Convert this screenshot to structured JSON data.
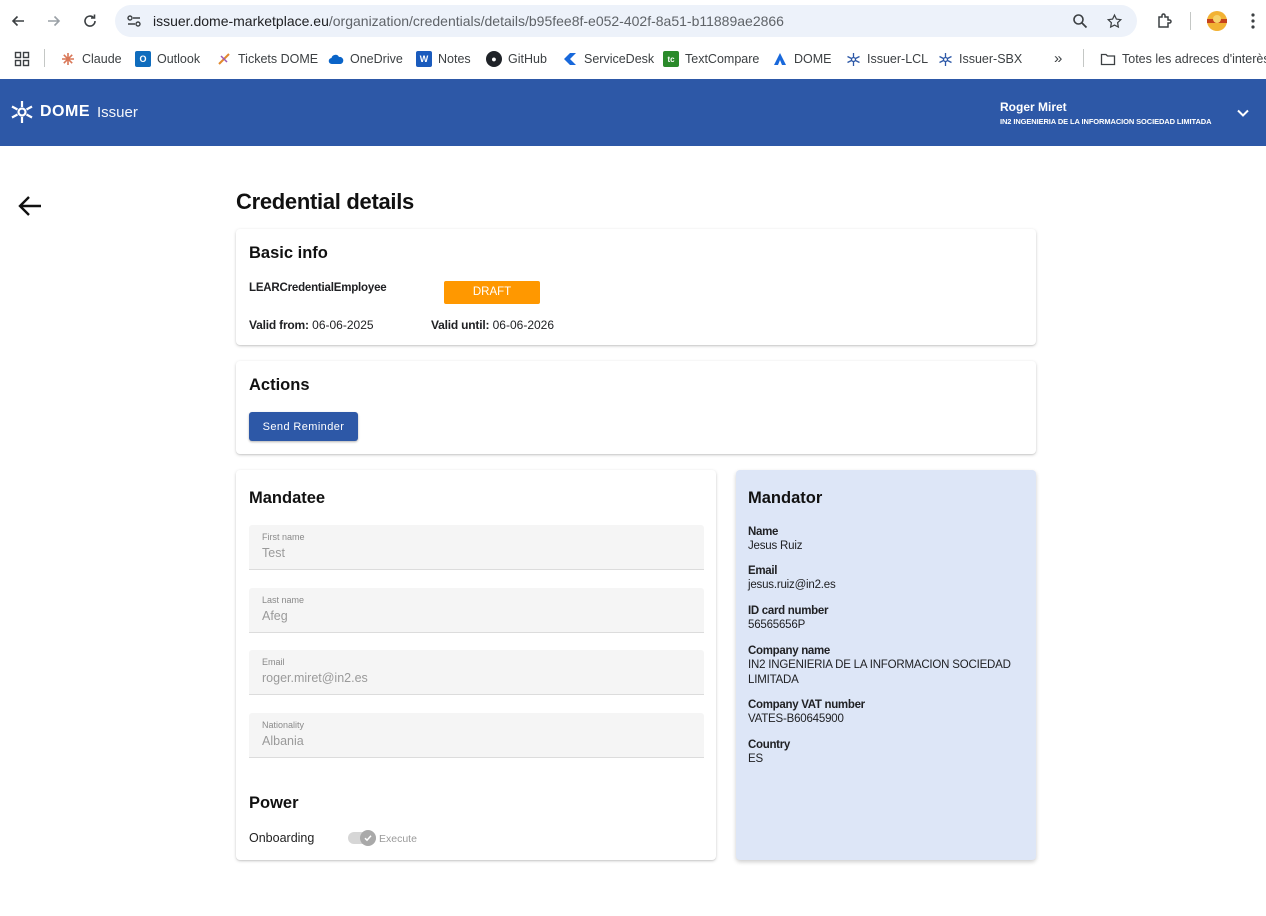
{
  "browser": {
    "url_host": "issuer.dome-marketplace.eu",
    "url_path": "/organization/credentials/details/b95fee8f-e052-402f-8a51-b11889ae2866",
    "bookmarks": [
      {
        "label": "Claude",
        "icon": "claude-icon",
        "color": "#d97757"
      },
      {
        "label": "Outlook",
        "icon": "outlook-icon",
        "color": "#0f6cbd"
      },
      {
        "label": "Tickets DOME",
        "icon": "tickets-icon",
        "color": "#e2892e"
      },
      {
        "label": "OneDrive",
        "icon": "onedrive-icon",
        "color": "#0a64c8"
      },
      {
        "label": "Notes",
        "icon": "word-icon",
        "color": "#1a5bbd"
      },
      {
        "label": "GitHub",
        "icon": "github-icon",
        "color": "#1f2328"
      },
      {
        "label": "ServiceDesk",
        "icon": "servicedesk-icon",
        "color": "#1868db"
      },
      {
        "label": "TextCompare",
        "icon": "textcompare-icon",
        "color": "#2a8a2a"
      },
      {
        "label": "DOME",
        "icon": "dome-icon",
        "color": "#1868db"
      },
      {
        "label": "Issuer-LCL",
        "icon": "issuer-icon",
        "color": "#2d58a7"
      },
      {
        "label": "Issuer-SBX",
        "icon": "issuer-icon",
        "color": "#2d58a7"
      }
    ],
    "more_label": "»",
    "all_bookmarks_label": "Totes les adreces d'interès"
  },
  "header": {
    "brand": "DOME",
    "product": "Issuer",
    "user_name": "Roger Miret",
    "user_org": "IN2 INGENIERIA DE LA INFORMACION SOCIEDAD LIMITADA",
    "color": "#2d58a7"
  },
  "page": {
    "title": "Credential details"
  },
  "basic_info": {
    "title": "Basic info",
    "credential_type": "LEARCredentialEmployee",
    "status": "DRAFT",
    "status_color": "#ff9800",
    "valid_from_label": "Valid from:",
    "valid_from": "06-06-2025",
    "valid_until_label": "Valid until:",
    "valid_until": "06-06-2026"
  },
  "actions": {
    "title": "Actions",
    "send_reminder_label": "Send Reminder"
  },
  "mandatee": {
    "title": "Mandatee",
    "fields": [
      {
        "label": "First name",
        "value": "Test"
      },
      {
        "label": "Last name",
        "value": "Afeg"
      },
      {
        "label": "Email",
        "value": "roger.miret@in2.es"
      },
      {
        "label": "Nationality",
        "value": "Albania"
      }
    ],
    "power_title": "Power",
    "power_label": "Onboarding",
    "power_action": "Execute",
    "power_enabled": true
  },
  "mandator": {
    "title": "Mandator",
    "items": [
      {
        "label": "Name",
        "value": "Jesus Ruiz"
      },
      {
        "label": "Email",
        "value": "jesus.ruiz@in2.es"
      },
      {
        "label": "ID card number",
        "value": "56565656P"
      },
      {
        "label": "Company name",
        "value": "IN2 INGENIERIA DE LA INFORMACION SOCIEDAD LIMITADA"
      },
      {
        "label": "Company VAT number",
        "value": "VATES-B60645900"
      },
      {
        "label": "Country",
        "value": "ES"
      }
    ]
  }
}
